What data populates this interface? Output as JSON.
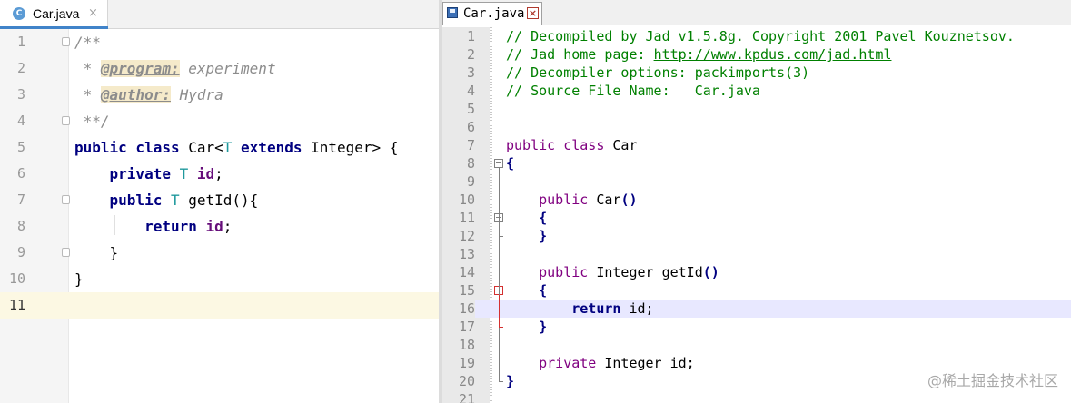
{
  "left_editor": {
    "tab": {
      "icon_letter": "C",
      "label": "Car.java",
      "close": "×"
    },
    "lines": [
      {
        "num": "1",
        "parts": [
          {
            "t": "/**",
            "c": "cmt"
          }
        ]
      },
      {
        "num": "2",
        "parts": [
          {
            "t": " * ",
            "c": "cmt"
          },
          {
            "t": "@program:",
            "c": "tag"
          },
          {
            "t": " experiment",
            "c": "cmt"
          }
        ]
      },
      {
        "num": "3",
        "parts": [
          {
            "t": " * ",
            "c": "cmt"
          },
          {
            "t": "@author:",
            "c": "tag"
          },
          {
            "t": " Hydra",
            "c": "cmt"
          }
        ]
      },
      {
        "num": "4",
        "parts": [
          {
            "t": " **/",
            "c": "cmt"
          }
        ]
      },
      {
        "num": "5",
        "parts": [
          {
            "t": "public class ",
            "c": "kw"
          },
          {
            "t": "Car<",
            "c": ""
          },
          {
            "t": "T",
            "c": "tp"
          },
          {
            "t": " extends ",
            "c": "kw"
          },
          {
            "t": "Integer> {",
            "c": ""
          }
        ]
      },
      {
        "num": "6",
        "parts": [
          {
            "t": "    "
          },
          {
            "t": "private ",
            "c": "kw"
          },
          {
            "t": "T ",
            "c": "tp"
          },
          {
            "t": "id",
            "c": "fld"
          },
          {
            "t": ";",
            "c": ""
          }
        ]
      },
      {
        "num": "7",
        "parts": [
          {
            "t": "    "
          },
          {
            "t": "public ",
            "c": "kw"
          },
          {
            "t": "T ",
            "c": "tp"
          },
          {
            "t": "getId(){",
            "c": ""
          }
        ]
      },
      {
        "num": "8",
        "parts": [
          {
            "t": "        "
          },
          {
            "t": "return ",
            "c": "kw"
          },
          {
            "t": "id",
            "c": "fld"
          },
          {
            "t": ";",
            "c": ""
          }
        ]
      },
      {
        "num": "9",
        "parts": [
          {
            "t": "    }",
            "c": ""
          }
        ]
      },
      {
        "num": "10",
        "parts": [
          {
            "t": "}",
            "c": ""
          }
        ]
      },
      {
        "num": "11",
        "parts": []
      }
    ]
  },
  "right_editor": {
    "tab": {
      "label": "Car.java",
      "close": "×"
    },
    "lines": [
      {
        "num": "1",
        "parts": [
          {
            "t": "// Decompiled by Jad v1.5.8g. Copyright 2001 Pavel Kouznetsov.",
            "c": "rcmt"
          }
        ]
      },
      {
        "num": "2",
        "parts": [
          {
            "t": "// Jad home page: ",
            "c": "rcmt"
          },
          {
            "t": "http://www.kpdus.com/jad.html",
            "c": "rlink"
          }
        ]
      },
      {
        "num": "3",
        "parts": [
          {
            "t": "// Decompiler options: packimports(3)",
            "c": "rcmt"
          }
        ]
      },
      {
        "num": "4",
        "parts": [
          {
            "t": "// Source File Name:   Car.java",
            "c": "rcmt"
          }
        ]
      },
      {
        "num": "5",
        "parts": []
      },
      {
        "num": "6",
        "parts": []
      },
      {
        "num": "7",
        "parts": [
          {
            "t": "public class ",
            "c": "rkw"
          },
          {
            "t": "Car",
            "c": ""
          }
        ]
      },
      {
        "num": "8",
        "parts": [
          {
            "t": "{",
            "c": "rbr"
          }
        ]
      },
      {
        "num": "9",
        "parts": []
      },
      {
        "num": "10",
        "parts": [
          {
            "t": "    "
          },
          {
            "t": "public ",
            "c": "rkw"
          },
          {
            "t": "Car",
            "c": ""
          },
          {
            "t": "()",
            "c": "rbr"
          }
        ]
      },
      {
        "num": "11",
        "parts": [
          {
            "t": "    "
          },
          {
            "t": "{",
            "c": "rbr"
          }
        ]
      },
      {
        "num": "12",
        "parts": [
          {
            "t": "    "
          },
          {
            "t": "}",
            "c": "rbr"
          }
        ]
      },
      {
        "num": "13",
        "parts": []
      },
      {
        "num": "14",
        "parts": [
          {
            "t": "    "
          },
          {
            "t": "public ",
            "c": "rkw"
          },
          {
            "t": "Integer getId",
            "c": ""
          },
          {
            "t": "()",
            "c": "rbr"
          }
        ]
      },
      {
        "num": "15",
        "parts": [
          {
            "t": "    "
          },
          {
            "t": "{",
            "c": "rbr"
          }
        ]
      },
      {
        "num": "16",
        "parts": [
          {
            "t": "        "
          },
          {
            "t": "return",
            "c": "rkwb"
          },
          {
            "t": " id;",
            "c": ""
          }
        ]
      },
      {
        "num": "17",
        "parts": [
          {
            "t": "    "
          },
          {
            "t": "}",
            "c": "rbr"
          }
        ]
      },
      {
        "num": "18",
        "parts": []
      },
      {
        "num": "19",
        "parts": [
          {
            "t": "    "
          },
          {
            "t": "private ",
            "c": "rkw"
          },
          {
            "t": "Integer id;",
            "c": ""
          }
        ]
      },
      {
        "num": "20",
        "parts": [
          {
            "t": "}",
            "c": "rbr"
          }
        ]
      },
      {
        "num": "21",
        "parts": []
      }
    ]
  },
  "watermark": "@稀土掘金技术社区"
}
